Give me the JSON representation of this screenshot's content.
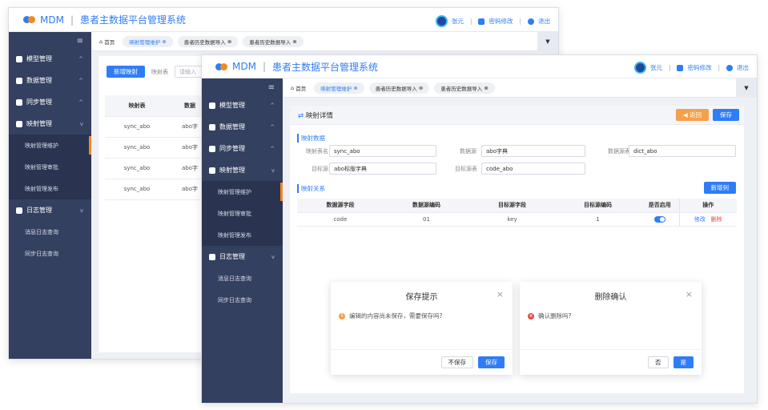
{
  "app": {
    "brand": "MDM",
    "divider": "|",
    "title": "患者主数据平台管理系统",
    "user": "张元",
    "sep1": "|",
    "change_password": "密码修改",
    "sep2": "|",
    "logout": "退出",
    "collapse_icon": "hamburger-icon",
    "dropdown_icon": "▼"
  },
  "sidebar": {
    "items": [
      {
        "label": "模型管理",
        "caret": "^"
      },
      {
        "label": "数据管理",
        "caret": "^"
      },
      {
        "label": "同步管理",
        "caret": "^"
      },
      {
        "label": "映射管理",
        "caret": "v"
      },
      {
        "label": "映射管理维护"
      },
      {
        "label": "映射管理审批"
      },
      {
        "label": "映射管理发布"
      },
      {
        "label": "日志管理",
        "caret": "v"
      },
      {
        "label": "消息日志查询"
      },
      {
        "label": "同步日志查询"
      }
    ]
  },
  "tabs": {
    "home": "首页",
    "t1": "映射管理维护",
    "t2": "患者历史数据导入",
    "t3": "患者历史数据导入",
    "close": "⊗"
  },
  "list": {
    "add_button": "新增映射",
    "filter_label": "映射表",
    "filter_placeholder": "请输入",
    "headers": [
      "映射表",
      "数据"
    ],
    "rows": [
      [
        "sync_abo",
        "abo字"
      ],
      [
        "sync_abo",
        "abo字"
      ],
      [
        "sync_abo",
        "abo字"
      ],
      [
        "sync_abo",
        "abo字"
      ]
    ]
  },
  "detail": {
    "title": "映射详情",
    "back": "返回",
    "save": "保存",
    "section_data": "映射数据",
    "label_table": "映射表名",
    "value_table": "sync_abo",
    "label_source": "数据源",
    "value_source": "abo字典",
    "label_source_table": "数据源表",
    "value_source_table": "dict_abo",
    "label_target": "目标源",
    "value_target": "abo标版字典",
    "label_target_table": "目标源表",
    "value_target_table": "code_abo",
    "section_relation": "映射关系",
    "add_column": "新增列",
    "headers": [
      "数据源字段",
      "数据源编码",
      "目标源字段",
      "目标源编码",
      "是否启用",
      "操作"
    ],
    "row": {
      "src_field": "code",
      "src_code": "01",
      "tgt_field": "key",
      "tgt_code": "1",
      "edit": "修改",
      "delete": "删除"
    }
  },
  "dialog_save": {
    "title": "保存提示",
    "close": "×",
    "message": "编辑的内容尚未保存，需要保存吗?",
    "no": "不保存",
    "yes": "保存"
  },
  "dialog_delete": {
    "title": "删除确认",
    "close": "×",
    "message": "确认删除吗?",
    "no": "否",
    "yes": "是"
  },
  "colors": {
    "accent": "#2f7df6",
    "sidebar": "#34405f",
    "orange": "#f08a24",
    "danger": "#e84a4a"
  }
}
